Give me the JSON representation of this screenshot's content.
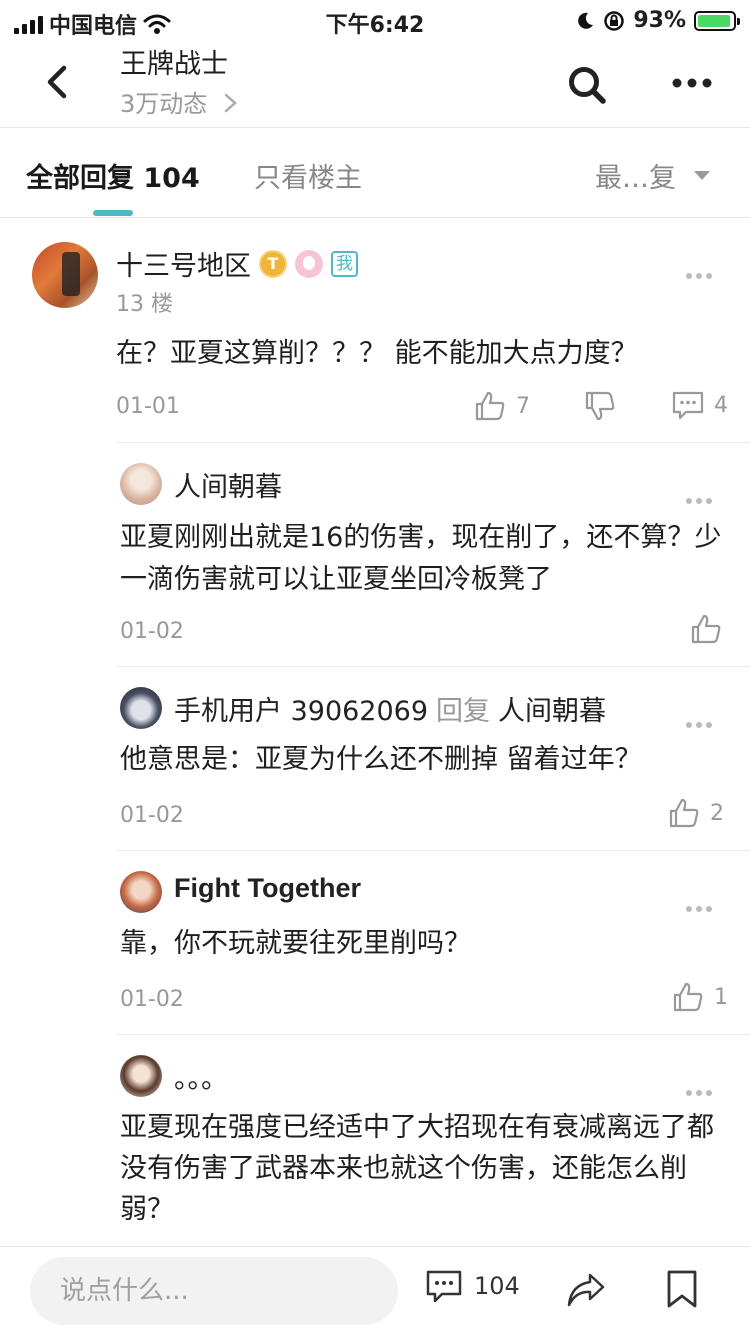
{
  "status_bar": {
    "carrier": "中国电信",
    "time": "下午6:42",
    "battery": "93%",
    "battery_level": 0.93
  },
  "header": {
    "title": "王牌战士",
    "subtitle": "3万动态",
    "icons": [
      "back-icon",
      "search-icon",
      "more-icon"
    ]
  },
  "tabs": {
    "all_label": "全部回复 104",
    "owner_label": "只看楼主",
    "sort_label": "最…复"
  },
  "main_post": {
    "username": "十三号地区",
    "badge_t": "T",
    "badge_me": "我",
    "floor": "13 楼",
    "text": "在？亚夏这算削？？？ 能不能加大点力度？",
    "date": "01-01",
    "likes": "7",
    "comments": "4"
  },
  "replies": [
    {
      "username": "人间朝暮",
      "reply_word": "",
      "reply_to": "",
      "text": "亚夏刚刚出就是16的伤害，现在削了，还不算？少一滴伤害就可以让亚夏坐回冷板凳了",
      "date": "01-02",
      "likes": ""
    },
    {
      "username": "手机用户 39062069",
      "reply_word": "回复",
      "reply_to": "人间朝暮",
      "text": "他意思是：亚夏为什么还不删掉 留着过年？",
      "date": "01-02",
      "likes": "2"
    },
    {
      "username": "Fight Together",
      "reply_word": "",
      "reply_to": "",
      "text": "靠，你不玩就要往死里削吗？",
      "date": "01-02",
      "likes": "1"
    },
    {
      "username": "。。。",
      "reply_word": "",
      "reply_to": "",
      "text": "亚夏现在强度已经适中了大招现在有衰减离远了都没有伤害了武器本来也就这个伤害，还能怎么削弱？",
      "date": "",
      "likes": ""
    }
  ],
  "bottom_bar": {
    "input_placeholder": "说点什么...",
    "comment_count": "104"
  },
  "colors": {
    "accent": "#4fb8c4",
    "muted_text": "#999999",
    "badge_gold": "#f0b43a"
  }
}
